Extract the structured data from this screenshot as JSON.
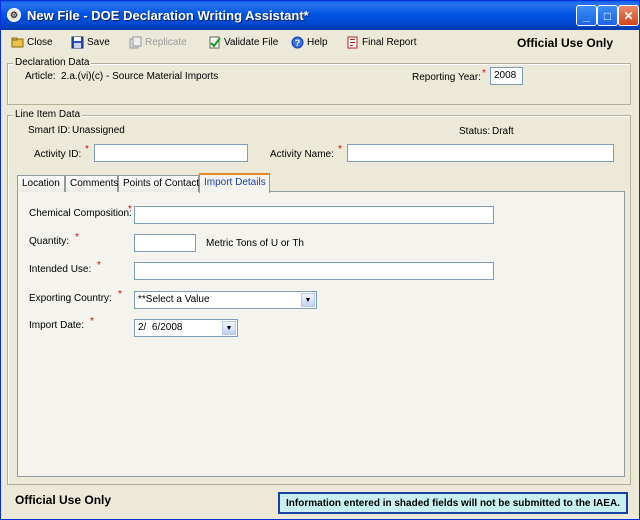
{
  "window": {
    "title": "New File - DOE Declaration Writing Assistant*",
    "controls": {
      "minimize": "_",
      "maximize": "□",
      "close": "✕"
    }
  },
  "toolbar": {
    "close": "Close",
    "save": "Save",
    "replicate": "Replicate",
    "validate": "Validate File",
    "help": "Help",
    "final_report": "Final Report",
    "official_use": "Official Use Only"
  },
  "declaration": {
    "legend": "Declaration Data",
    "article_label": "Article:",
    "article_value": "2.a.(vi)(c) - Source Material Imports",
    "reporting_year_label": "Reporting Year:",
    "reporting_year_value": "2008"
  },
  "line_item": {
    "legend": "Line Item Data",
    "smart_id_label": "Smart ID:",
    "smart_id_value": "Unassigned",
    "status_label": "Status:",
    "status_value": "Draft",
    "activity_id_label": "Activity ID:",
    "activity_id_value": "",
    "activity_name_label": "Activity Name:",
    "activity_name_value": ""
  },
  "tabs": [
    "Location",
    "Comments",
    "Points of Contact",
    "Import Details"
  ],
  "active_tab": "Import Details",
  "import_details": {
    "chemical_label": "Chemical Composition:",
    "chemical_value": "",
    "quantity_label": "Quantity:",
    "quantity_value": "",
    "quantity_unit": "Metric Tons of U or Th",
    "intended_use_label": "Intended Use:",
    "intended_use_value": "",
    "exporting_country_label": "Exporting Country:",
    "exporting_country_value": "**Select a Value",
    "import_date_label": "Import Date:",
    "import_date_value": "2/  6/2008"
  },
  "required_marker": "*",
  "footer": {
    "official_use": "Official Use Only",
    "info": "Information entered in shaded fields will not be submitted to the IAEA."
  },
  "colors": {
    "titlebar": "#0054e3",
    "required": "#dd0000",
    "info_bg": "#c8f0f0",
    "active_tab_text": "#1b3fa1"
  },
  "icons": {
    "app": "app-icon",
    "close": "folder-close-icon",
    "save": "save-disk-icon",
    "replicate": "replicate-icon",
    "validate": "validate-check-icon",
    "help": "help-icon",
    "final_report": "report-icon"
  }
}
